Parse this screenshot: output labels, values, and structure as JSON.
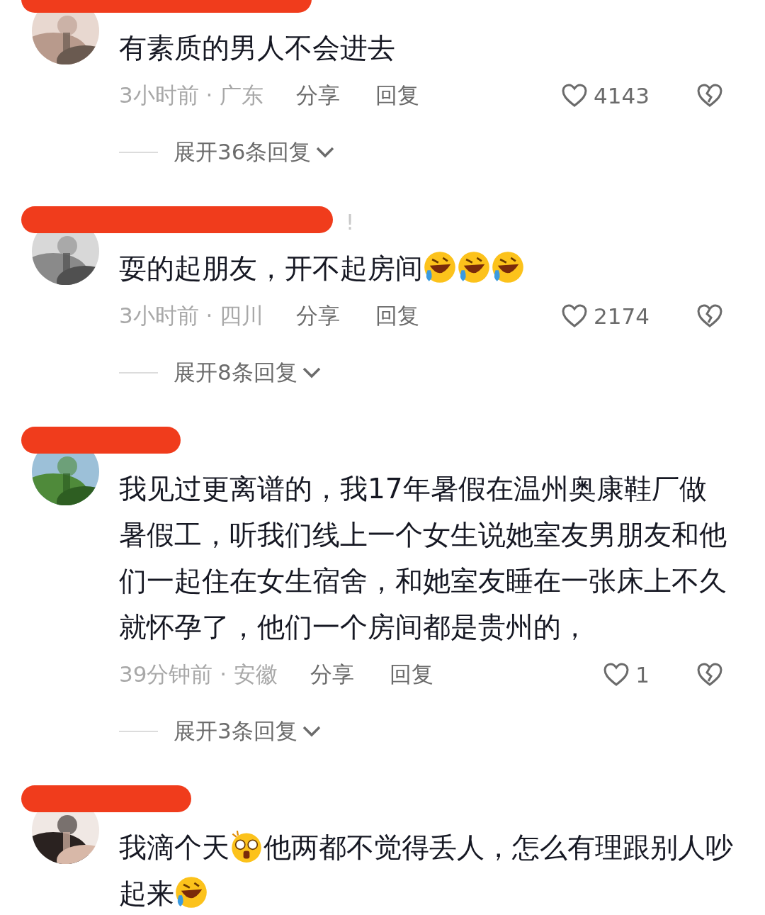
{
  "comments": [
    {
      "body": [
        {
          "kind": "text",
          "text": "有素质的男人不会进去"
        }
      ],
      "time": "3小时前 · 广东",
      "share": "分享",
      "reply": "回复",
      "likes": "4143",
      "expand": "展开36条回复"
    },
    {
      "note": "!",
      "body": [
        {
          "kind": "text",
          "text": "耍的起朋友，开不起房间"
        },
        {
          "kind": "laugh"
        },
        {
          "kind": "laugh"
        },
        {
          "kind": "laugh"
        }
      ],
      "time": "3小时前 · 四川",
      "share": "分享",
      "reply": "回复",
      "likes": "2174",
      "expand": "展开8条回复"
    },
    {
      "body": [
        {
          "kind": "text",
          "text": "我见过更离谱的，我17年暑假在温州奥康鞋厂做暑假工，听我们线上一个女生说她室友男朋友和他们一起住在女生宿舍，和她室友睡在一张床上不久就怀孕了，他们一个房间都是贵州的，"
        }
      ],
      "time": "39分钟前 · 安徽",
      "share": "分享",
      "reply": "回复",
      "likes": "1",
      "expand": "展开3条回复"
    },
    {
      "body": [
        {
          "kind": "text",
          "text": "我滴个天"
        },
        {
          "kind": "shock"
        },
        {
          "kind": "text",
          "text": "他两都不觉得丢人，怎么有理跟别人吵起来"
        },
        {
          "kind": "laugh"
        }
      ]
    }
  ]
}
